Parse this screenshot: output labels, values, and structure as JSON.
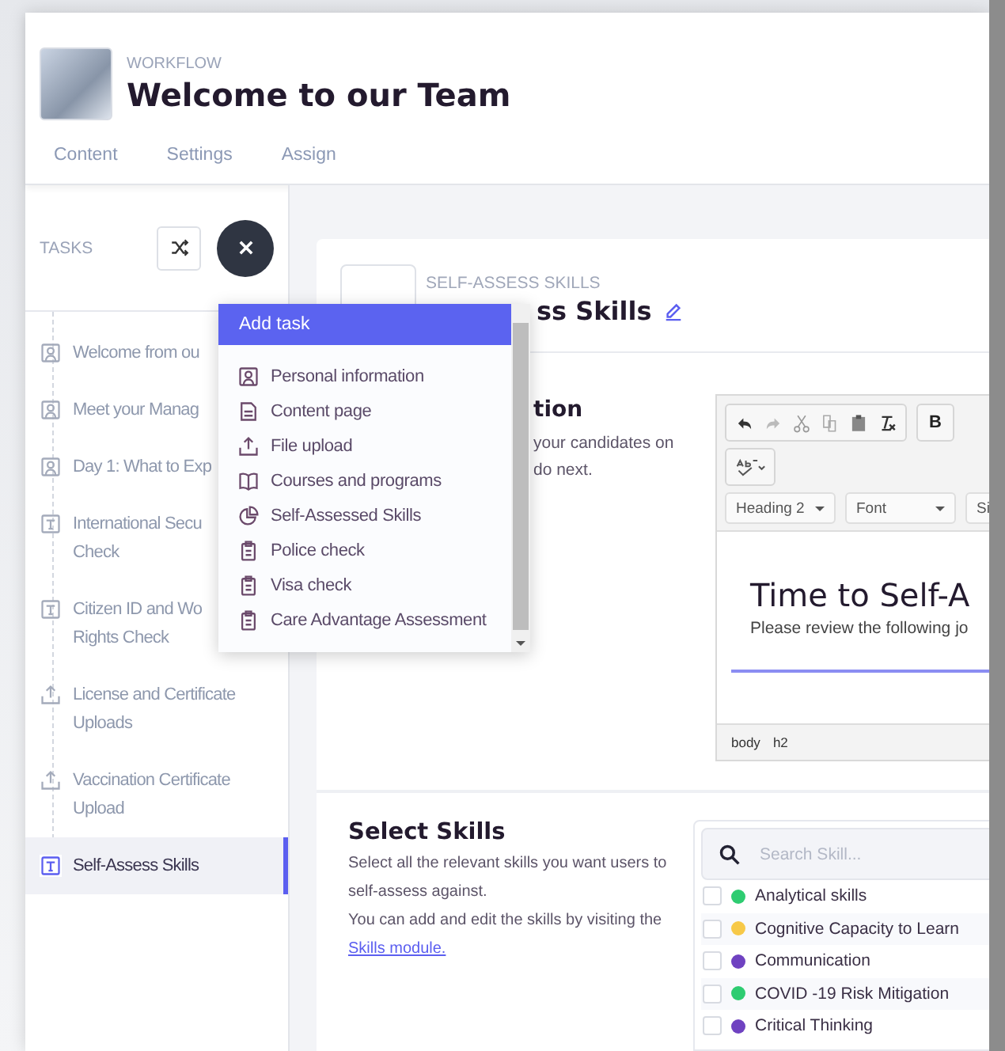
{
  "header": {
    "label": "WORKFLOW",
    "title": "Welcome to our Team"
  },
  "tabs": [
    {
      "label": "Content",
      "selected": false
    },
    {
      "label": "Settings",
      "selected": false
    },
    {
      "label": "Assign",
      "selected": false
    }
  ],
  "sidebar": {
    "title": "TASKS",
    "items": [
      {
        "kind": "person",
        "lines": [
          "Welcome from ou"
        ],
        "selected": false
      },
      {
        "kind": "person",
        "lines": [
          "Meet your Manag"
        ],
        "selected": false
      },
      {
        "kind": "person",
        "lines": [
          "Day 1: What to Exp"
        ],
        "selected": false
      },
      {
        "kind": "text",
        "lines": [
          "International Secu",
          "Check"
        ],
        "selected": false
      },
      {
        "kind": "text",
        "lines": [
          "Citizen ID and Wo",
          "Rights Check"
        ],
        "selected": false
      },
      {
        "kind": "upload",
        "lines": [
          "License and Certificate",
          "Uploads"
        ],
        "selected": false
      },
      {
        "kind": "upload",
        "lines": [
          "Vaccination Certificate",
          "Upload"
        ],
        "selected": false
      },
      {
        "kind": "text",
        "lines": [
          "Self-Assess Skills"
        ],
        "selected": true
      }
    ]
  },
  "add_task_menu": {
    "title": "Add task",
    "items": [
      {
        "kind": "person",
        "label": "Personal information"
      },
      {
        "kind": "page",
        "label": "Content page"
      },
      {
        "kind": "upload",
        "label": "File upload"
      },
      {
        "kind": "book",
        "label": "Courses and programs"
      },
      {
        "kind": "pie",
        "label": "Self-Assessed Skills"
      },
      {
        "kind": "clipboard",
        "label": "Police check"
      },
      {
        "kind": "clipboard",
        "label": "Visa check"
      },
      {
        "kind": "clipboard",
        "label": "Care Advantage Assessment"
      }
    ]
  },
  "task": {
    "type_label": "SELF-ASSESS SKILLS",
    "title": "ss Skills"
  },
  "introduction": {
    "heading": "tion",
    "lines": [
      "your candidates on",
      "do next."
    ]
  },
  "editor": {
    "bold": "B",
    "format": "Heading 2",
    "font": "Font",
    "size": "Si",
    "heading": "Time to Self-A",
    "body": "Please review the following jo",
    "path": [
      "body",
      "h2"
    ]
  },
  "select_skills": {
    "heading": "Select Skills",
    "description": "Select all the relevant skills you want users to self-assess against.",
    "note": "You can add and edit the skills by visiting the",
    "link": "Skills module.",
    "search": {
      "placeholder": "Search Skill..."
    },
    "skills": [
      {
        "label": "Analytical skills",
        "color": "#2ecc71",
        "checked": false
      },
      {
        "label": "Cognitive Capacity to Learn",
        "color": "#f7c948",
        "checked": false
      },
      {
        "label": "Communication",
        "color": "#6f42c1",
        "checked": false
      },
      {
        "label": "COVID -19 Risk Mitigation",
        "color": "#2ecc71",
        "checked": false
      },
      {
        "label": "Critical Thinking",
        "color": "#6f42c1",
        "checked": false
      }
    ]
  }
}
